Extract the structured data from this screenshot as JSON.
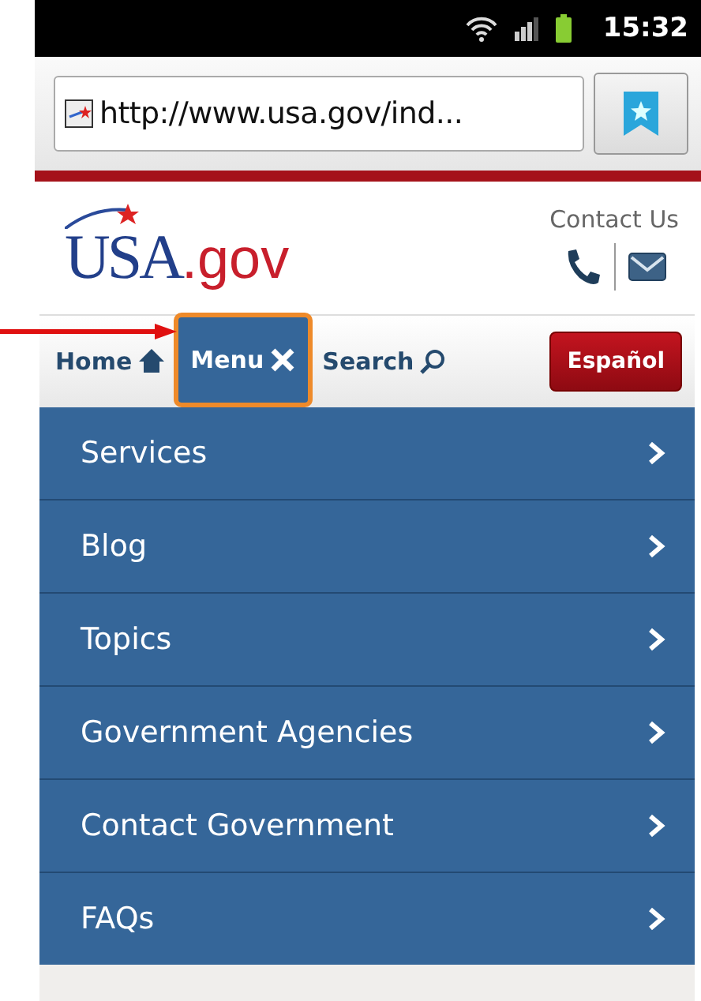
{
  "status_bar": {
    "time": "15:32"
  },
  "address_bar": {
    "url": "http://www.usa.gov/ind..."
  },
  "header": {
    "logo": {
      "main": "USA",
      "suffix": ".gov"
    },
    "contact": {
      "label": "Contact Us"
    }
  },
  "nav": {
    "items": [
      {
        "label": "Home",
        "kind": "home",
        "selected": false
      },
      {
        "label": "Menu",
        "kind": "close",
        "selected": true
      },
      {
        "label": "Search",
        "kind": "search",
        "selected": false
      }
    ],
    "language_button": "Español"
  },
  "menu": {
    "items": [
      {
        "label": "Services"
      },
      {
        "label": "Blog"
      },
      {
        "label": "Topics"
      },
      {
        "label": "Government Agencies"
      },
      {
        "label": "Contact Government"
      },
      {
        "label": "FAQs"
      }
    ]
  },
  "annotation": {
    "kind": "arrow"
  }
}
